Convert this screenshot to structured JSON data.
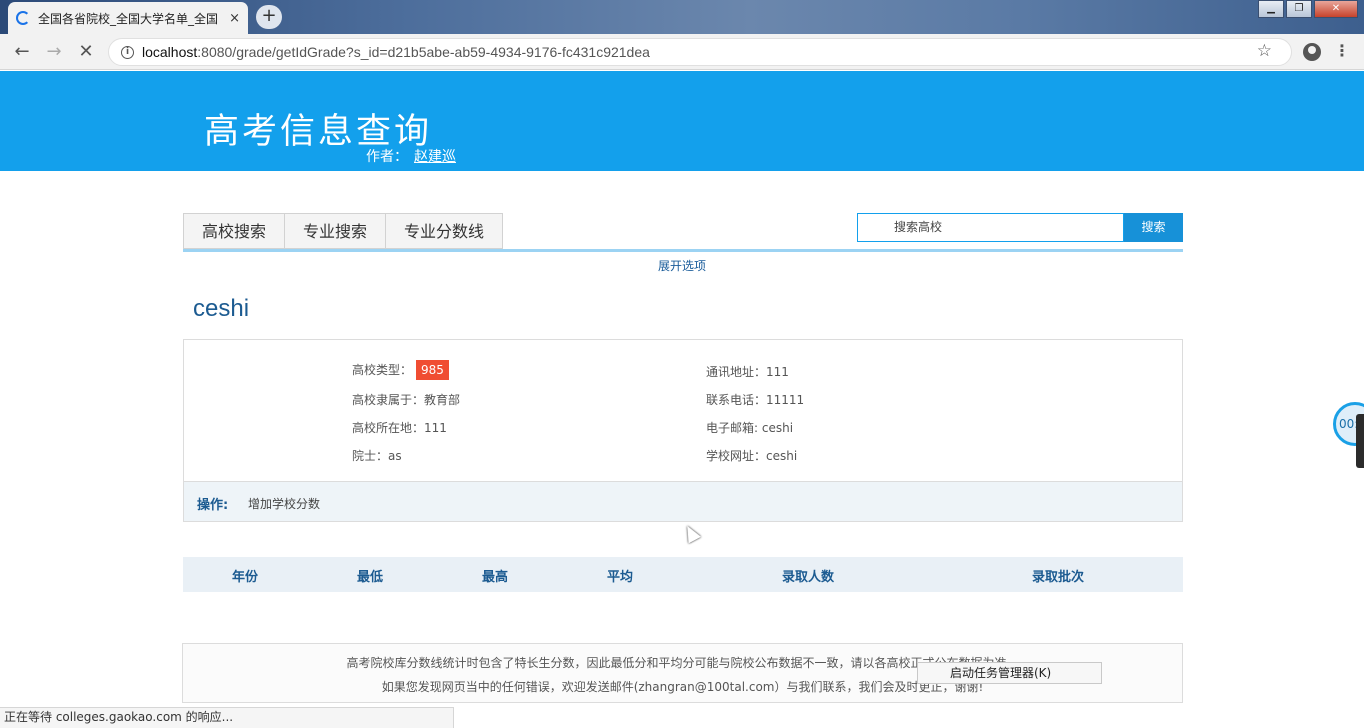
{
  "browser": {
    "tab_title": "全国各省院校_全国大学名单_全国",
    "tab_close": "×",
    "new_tab": "+",
    "url_host": "localhost",
    "url_rest": ":8080/grade/getIdGrade?s_id=d21b5abe-ab59-4934-9176-fc431c921dea",
    "status_text": "正在等待 colleges.gaokao.com 的响应..."
  },
  "header": {
    "title": "高考信息查询",
    "author_label": "作者：",
    "author_name": "赵建巡"
  },
  "nav": {
    "tabs": [
      "高校搜索",
      "专业搜索",
      "专业分数线"
    ],
    "search_placeholder": "搜索高校",
    "search_button": "搜索",
    "expand_options": "展开选项"
  },
  "school": {
    "name": "ceshi",
    "type_label": "高校类型：",
    "type_value": "985",
    "affiliation": "高校隶属于：教育部",
    "location": "高校所在地：111",
    "academician": "院士：as",
    "address": "通讯地址：111",
    "phone": "联系电话：11111",
    "email": "电子邮箱: ceshi",
    "website": "学校网址：ceshi",
    "op_label": "操作:",
    "op_add_score": "增加学校分数"
  },
  "score_table": {
    "headers": [
      "年份",
      "最低",
      "最高",
      "平均",
      "录取人数",
      "录取批次"
    ]
  },
  "footer": {
    "note_line1": "高考院校库分数线统计时包含了特长生分数，因此最低分和平均分可能与院校公布数据不一致，请以各高校正式公布数据为准。",
    "note_line2": "如果您发现网页当中的任何错误，欢迎发送邮件(zhangran@100tal.com）与我们联系，我们会及时更正，谢谢!"
  },
  "overlay": {
    "tooltip": "启动任务管理器(K)",
    "float_timer": "00:"
  },
  "colors": {
    "banner": "#13a0ec",
    "accent_text": "#1c5b91",
    "badge": "#f04d32"
  }
}
